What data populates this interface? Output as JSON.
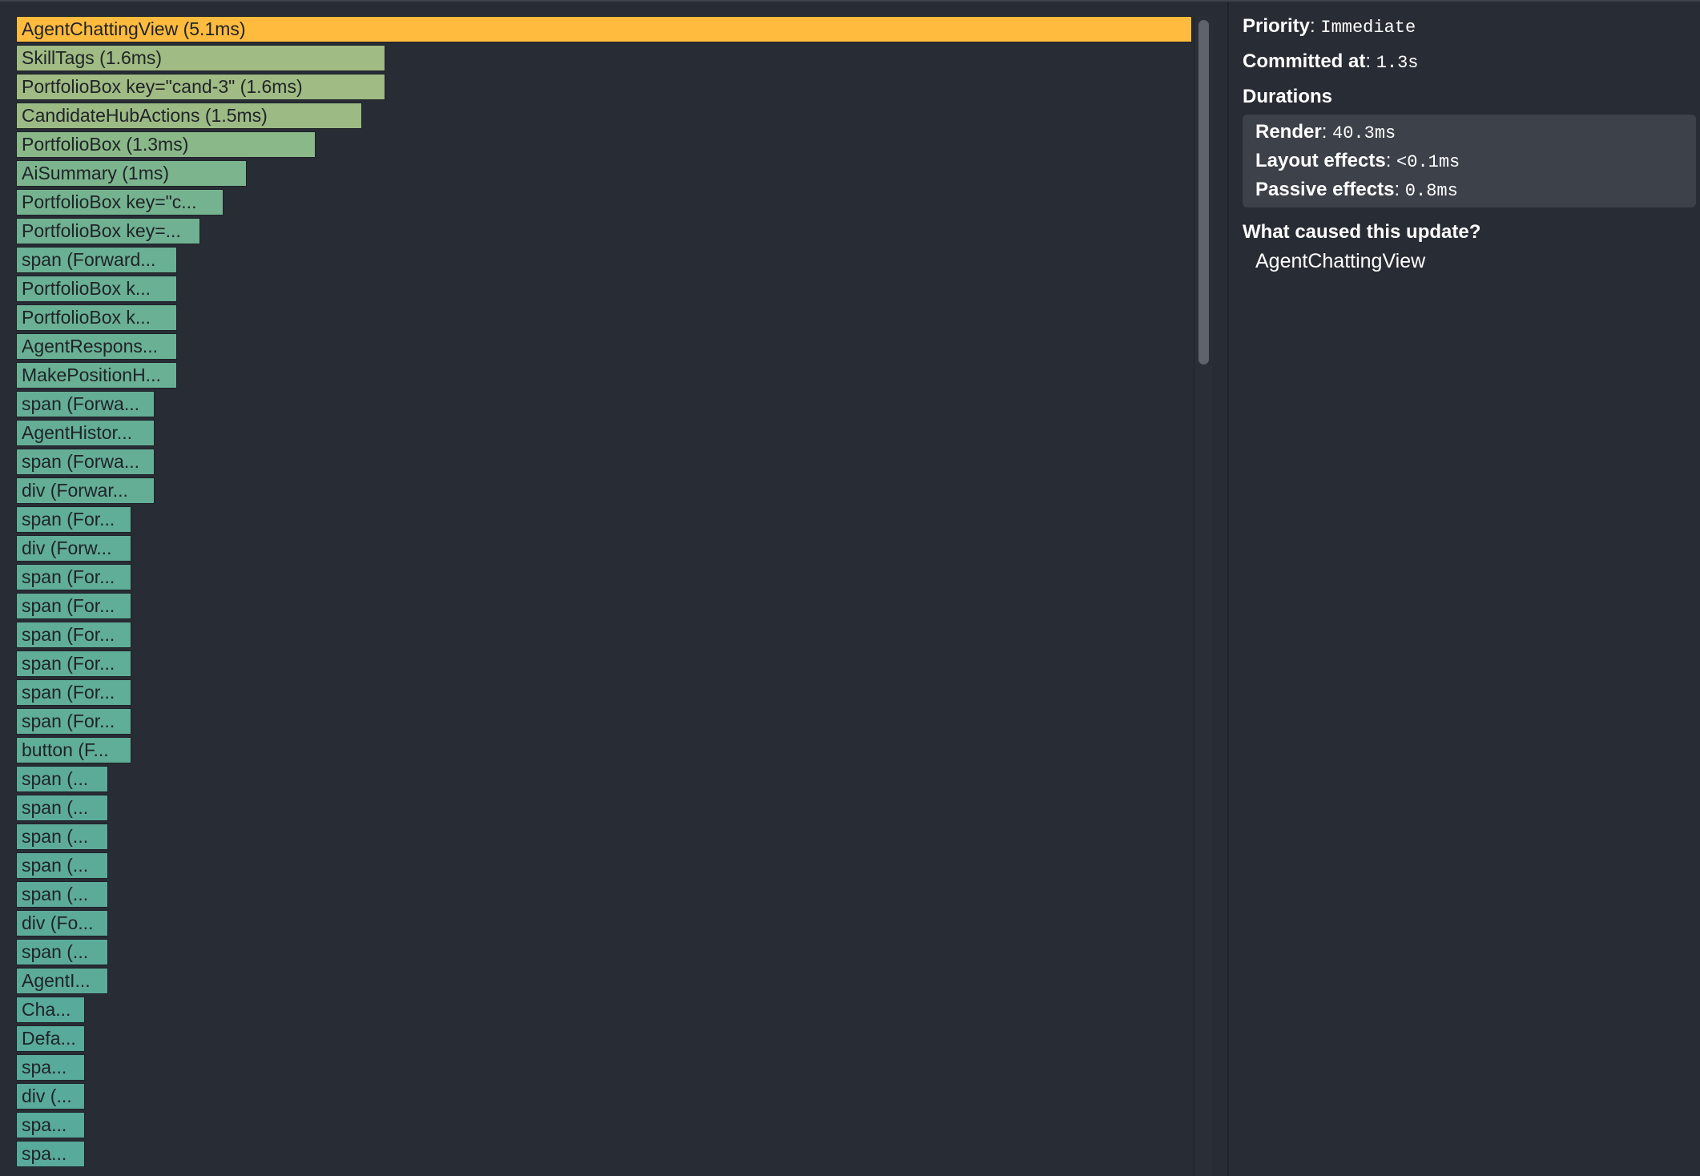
{
  "flamegraph": {
    "bars": [
      {
        "label": "AgentChattingView (5.1ms)",
        "duration_ms": 5.1,
        "color": "#ffbb3d"
      },
      {
        "label": "SkillTags (1.6ms)",
        "duration_ms": 1.6,
        "color": "#a0bb83"
      },
      {
        "label": "PortfolioBox key=\"cand-3\" (1.6ms)",
        "duration_ms": 1.6,
        "color": "#a0bb83"
      },
      {
        "label": "CandidateHubActions (1.5ms)",
        "duration_ms": 1.5,
        "color": "#9cba84"
      },
      {
        "label": "PortfolioBox (1.3ms)",
        "duration_ms": 1.3,
        "color": "#8ab888"
      },
      {
        "label": "AiSummary (1ms)",
        "duration_ms": 1.0,
        "color": "#7cb48e"
      },
      {
        "label": "PortfolioBox key=\"c...",
        "duration_ms": 0.9,
        "color": "#75b390"
      },
      {
        "label": "PortfolioBox key=...",
        "duration_ms": 0.8,
        "color": "#6fb192"
      },
      {
        "label": "span (Forward...",
        "duration_ms": 0.7,
        "color": "#69b094"
      },
      {
        "label": "PortfolioBox k...",
        "duration_ms": 0.7,
        "color": "#69b094"
      },
      {
        "label": "PortfolioBox k...",
        "duration_ms": 0.7,
        "color": "#69b094"
      },
      {
        "label": "AgentRespons...",
        "duration_ms": 0.7,
        "color": "#69b094"
      },
      {
        "label": "MakePositionH...",
        "duration_ms": 0.7,
        "color": "#69b094"
      },
      {
        "label": "span (Forwa...",
        "duration_ms": 0.6,
        "color": "#64ae96"
      },
      {
        "label": "AgentHistor...",
        "duration_ms": 0.6,
        "color": "#64ae96"
      },
      {
        "label": "span (Forwa...",
        "duration_ms": 0.6,
        "color": "#64ae96"
      },
      {
        "label": "div (Forwar...",
        "duration_ms": 0.6,
        "color": "#64ae96"
      },
      {
        "label": "span (For...",
        "duration_ms": 0.5,
        "color": "#60ad98"
      },
      {
        "label": "div (Forw...",
        "duration_ms": 0.5,
        "color": "#60ad98"
      },
      {
        "label": "span (For...",
        "duration_ms": 0.5,
        "color": "#60ad98"
      },
      {
        "label": "span (For...",
        "duration_ms": 0.5,
        "color": "#60ad98"
      },
      {
        "label": "span (For...",
        "duration_ms": 0.5,
        "color": "#60ad98"
      },
      {
        "label": "span (For...",
        "duration_ms": 0.5,
        "color": "#60ad98"
      },
      {
        "label": "span (For...",
        "duration_ms": 0.5,
        "color": "#60ad98"
      },
      {
        "label": "span (For...",
        "duration_ms": 0.5,
        "color": "#60ad98"
      },
      {
        "label": "button (F...",
        "duration_ms": 0.5,
        "color": "#60ad98"
      },
      {
        "label": "span (...",
        "duration_ms": 0.4,
        "color": "#5cab99"
      },
      {
        "label": "span (...",
        "duration_ms": 0.4,
        "color": "#5cab99"
      },
      {
        "label": "span (...",
        "duration_ms": 0.4,
        "color": "#5cab99"
      },
      {
        "label": "span (...",
        "duration_ms": 0.4,
        "color": "#5cab99"
      },
      {
        "label": "span (...",
        "duration_ms": 0.4,
        "color": "#5cab99"
      },
      {
        "label": "div (Fo...",
        "duration_ms": 0.4,
        "color": "#5cab99"
      },
      {
        "label": "span (...",
        "duration_ms": 0.4,
        "color": "#5cab99"
      },
      {
        "label": "AgentI...",
        "duration_ms": 0.4,
        "color": "#5cab99"
      },
      {
        "label": "Cha...",
        "duration_ms": 0.3,
        "color": "#58aa9b"
      },
      {
        "label": "Defa...",
        "duration_ms": 0.3,
        "color": "#58aa9b"
      },
      {
        "label": "spa...",
        "duration_ms": 0.3,
        "color": "#58aa9b"
      },
      {
        "label": "div (...",
        "duration_ms": 0.3,
        "color": "#58aa9b"
      },
      {
        "label": "spa...",
        "duration_ms": 0.3,
        "color": "#58aa9b"
      },
      {
        "label": "spa...",
        "duration_ms": 0.3,
        "color": "#58aa9b"
      }
    ]
  },
  "details": {
    "priority_label": "Priority",
    "priority_value": "Immediate",
    "committed_label": "Committed at",
    "committed_value": "1.3s",
    "durations_title": "Durations",
    "render_label": "Render",
    "render_value": "40.3ms",
    "layout_label": "Layout effects",
    "layout_value": "<0.1ms",
    "passive_label": "Passive effects",
    "passive_value": "0.8ms",
    "cause_title": "What caused this update?",
    "cause_component": "AgentChattingView"
  }
}
